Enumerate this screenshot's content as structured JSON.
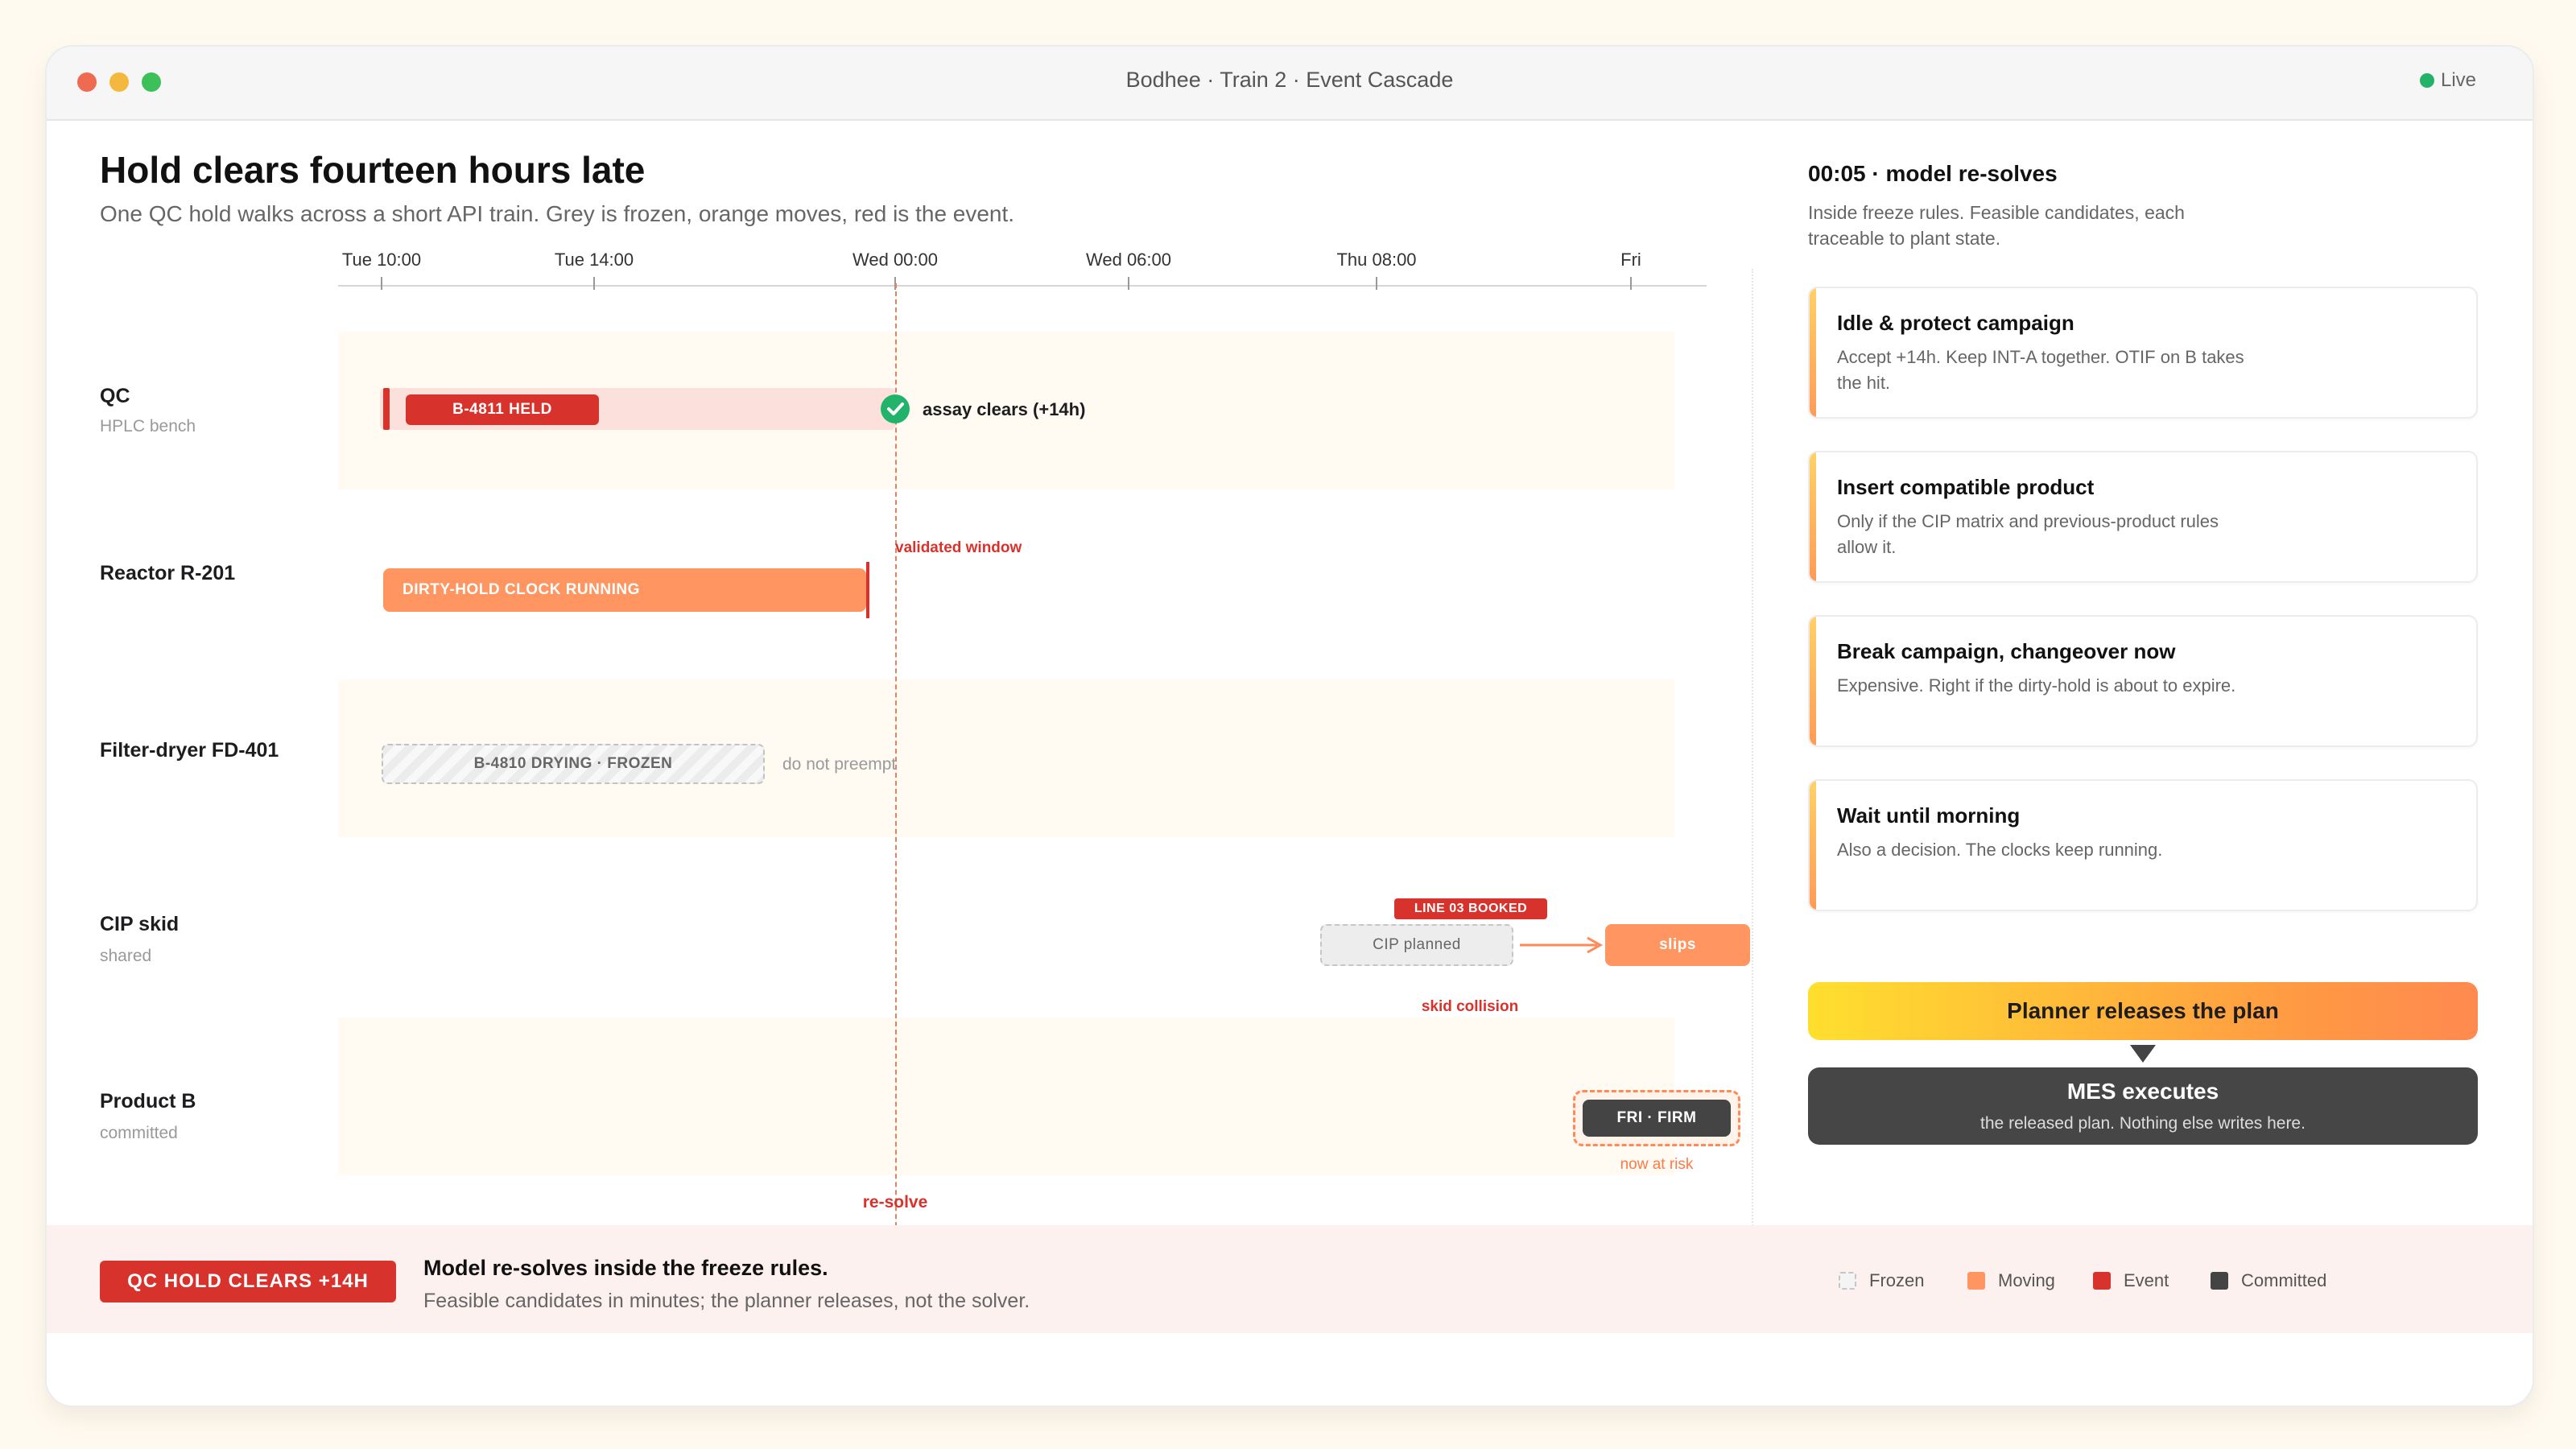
{
  "window": {
    "title": "Bodhee · Train 2 · Event Cascade",
    "status": "Live"
  },
  "header": {
    "title": "Hold clears fourteen hours late",
    "subtitle": "One QC hold walks across a short API train. Grey is frozen, orange moves, red is the event."
  },
  "timeline": {
    "ticks": [
      "Tue 10:00",
      "Tue 14:00",
      "Wed 00:00",
      "Wed 06:00",
      "Thu 08:00",
      "Fri"
    ],
    "event_label": "re-solve"
  },
  "rows": {
    "qc": {
      "label": "QC",
      "sub": "HPLC bench",
      "bar": "B-4811 HELD",
      "note": "assay clears (+14h)"
    },
    "reactor": {
      "label": "Reactor R-201",
      "bar": "DIRTY-HOLD CLOCK RUNNING",
      "note": "validated window"
    },
    "filter": {
      "label": "Filter-dryer FD-401",
      "bar": "B-4810 DRYING · FROZEN",
      "note": "do not preempt"
    },
    "cip": {
      "label": "CIP skid",
      "sub": "shared",
      "booked": "LINE 03 BOOKED",
      "planned": "CIP planned",
      "slips": "slips",
      "note": "skid collision"
    },
    "product": {
      "label": "Product B",
      "sub": "committed",
      "bar": "FRI · FIRM",
      "note": "now at risk"
    }
  },
  "panel": {
    "title": "00:05 · model re-solves",
    "subtitle": "Inside freeze rules. Feasible candidates, each traceable to plant state.",
    "cards": [
      {
        "title": "Idle & protect campaign",
        "desc": "Accept +14h. Keep INT-A together. OTIF on B takes the hit."
      },
      {
        "title": "Insert compatible product",
        "desc": "Only if the CIP matrix and previous-product rules allow it."
      },
      {
        "title": "Break campaign, changeover now",
        "desc": "Expensive. Right if the dirty-hold is about to expire."
      },
      {
        "title": "Wait until morning",
        "desc": "Also a decision. The clocks keep running."
      }
    ],
    "release_button": "Planner releases the plan",
    "mes_title": "MES executes",
    "mes_sub": "the released plan. Nothing else writes here."
  },
  "footer": {
    "badge": "QC HOLD CLEARS +14H",
    "title": "Model re-solves inside the freeze rules.",
    "subtitle": "Feasible candidates in minutes; the planner releases, not the solver.",
    "legend": [
      "Frozen",
      "Moving",
      "Event",
      "Committed"
    ]
  },
  "colors": {
    "event": "#d8322c",
    "moving": "#ff9560",
    "frozen": "#e4e4e4",
    "committed": "#444444",
    "ok": "#22b36a"
  }
}
